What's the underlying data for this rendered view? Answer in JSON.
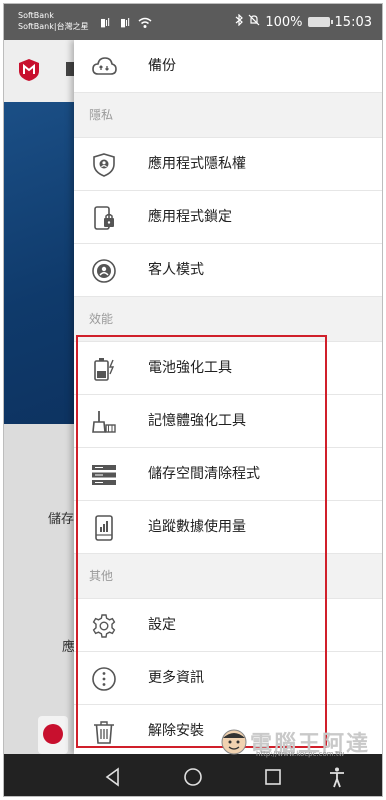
{
  "status_bar": {
    "carrier_1": "SoftBank",
    "carrier_2": "SoftBank|台灣之星",
    "signal_1": "▮ıl",
    "signal_2": "▮ıl",
    "battery": "100%",
    "time": "15:03",
    "icons": [
      "signal-icon",
      "signal-icon",
      "wifi-icon",
      "bluetooth-icon",
      "silent-icon",
      "battery-icon"
    ]
  },
  "background_app": {
    "label_1": "儲存",
    "label_2": "應"
  },
  "drawer": {
    "backup": {
      "label": "備份",
      "icon": "cloud-backup-icon"
    },
    "privacy": {
      "header": "隱私",
      "items": [
        {
          "label": "應用程式隱私權",
          "icon": "shield-user-icon"
        },
        {
          "label": "應用程式鎖定",
          "icon": "app-lock-icon"
        },
        {
          "label": "客人模式",
          "icon": "guest-mode-icon"
        }
      ]
    },
    "performance": {
      "header": "效能",
      "items": [
        {
          "label": "電池強化工具",
          "icon": "battery-booster-icon"
        },
        {
          "label": "記憶體強化工具",
          "icon": "memory-booster-icon"
        },
        {
          "label": "儲存空間清除程式",
          "icon": "storage-cleaner-icon"
        },
        {
          "label": "追蹤數據使用量",
          "icon": "data-usage-icon"
        }
      ]
    },
    "other": {
      "header": "其他",
      "items": [
        {
          "label": "設定",
          "icon": "gear-icon"
        },
        {
          "label": "更多資訊",
          "icon": "more-info-icon"
        },
        {
          "label": "解除安裝",
          "icon": "trash-icon"
        }
      ]
    }
  },
  "watermark": {
    "text": "電腦王阿達",
    "url": "http://www.kocpc.com.tw"
  },
  "nav_bar": {
    "buttons": [
      "back-icon",
      "home-icon",
      "recents-icon",
      "accessibility-icon"
    ]
  },
  "colors": {
    "highlight_border": "#d01f2a",
    "brand_red": "#c8102e",
    "status_bar_bg": "#5b5b5b",
    "nav_bar_bg": "#222222",
    "section_header_bg": "#f2f2f2"
  }
}
